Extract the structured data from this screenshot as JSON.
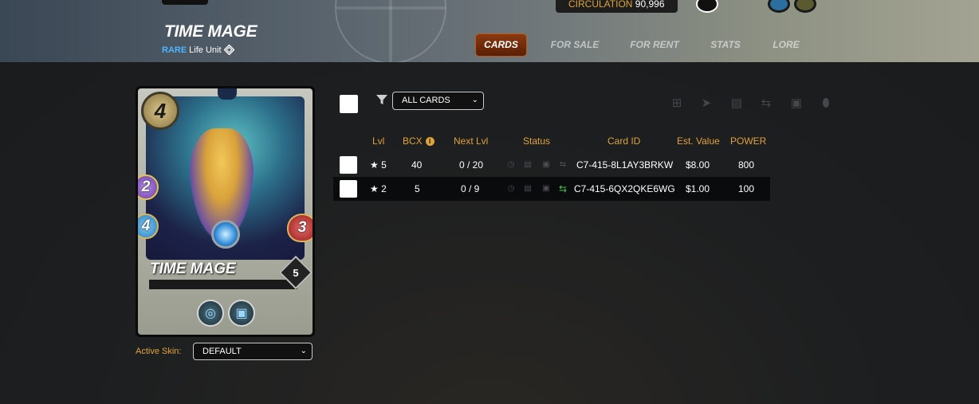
{
  "header": {
    "title": "TIME MAGE",
    "rarity": "RARE",
    "unit_type": "Life Unit",
    "circulation_label": "CIRCULATION",
    "circulation_value": "90,996",
    "tabs": [
      {
        "label": "CARDS",
        "active": true
      },
      {
        "label": "FOR SALE",
        "active": false
      },
      {
        "label": "FOR RENT",
        "active": false
      },
      {
        "label": "STATS",
        "active": false
      },
      {
        "label": "LORE",
        "active": false
      }
    ]
  },
  "card": {
    "name": "TIME MAGE",
    "mana": "4",
    "magic": "2",
    "speed": "4",
    "health": "3",
    "level": "5",
    "abilities": [
      "ability-1",
      "ability-2"
    ]
  },
  "skin": {
    "label": "Active Skin:",
    "value": "DEFAULT"
  },
  "filter": {
    "value": "ALL CARDS"
  },
  "table": {
    "columns": [
      "Lvl",
      "BCX",
      "Next Lvl",
      "Status",
      "Card ID",
      "Est. Value",
      "POWER"
    ],
    "rows": [
      {
        "lvl": "★ 5",
        "bcx": "40",
        "next_lvl": "0 / 20",
        "card_id": "C7-415-8L1AY3BRKW",
        "est_value": "$8.00",
        "power": "800",
        "transferring": false
      },
      {
        "lvl": "★ 2",
        "bcx": "5",
        "next_lvl": "0 / 9",
        "card_id": "C7-415-6QX2QKE6WG",
        "est_value": "$1.00",
        "power": "100",
        "transferring": true
      }
    ]
  },
  "colors": {
    "accent": "#e0a23a",
    "rarity": "#4fb3ff",
    "active_tab": "#8a3a10",
    "transfer_icon": "#4bc44b"
  }
}
